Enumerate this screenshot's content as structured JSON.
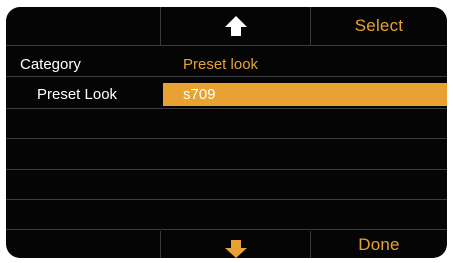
{
  "top_bar": {
    "up_icon": "up-arrow-icon",
    "select_label": "Select"
  },
  "bottom_bar": {
    "down_icon": "down-arrow-icon",
    "done_label": "Done"
  },
  "menu": {
    "category_label": "Category",
    "category_value": "Preset look",
    "preset_label": "Preset Look",
    "preset_value": "s709"
  },
  "colors": {
    "accent": "#e8a232",
    "background": "#050505",
    "divider": "#3c3c3c",
    "up_arrow": "#ffffff",
    "down_arrow": "#e8a232"
  }
}
